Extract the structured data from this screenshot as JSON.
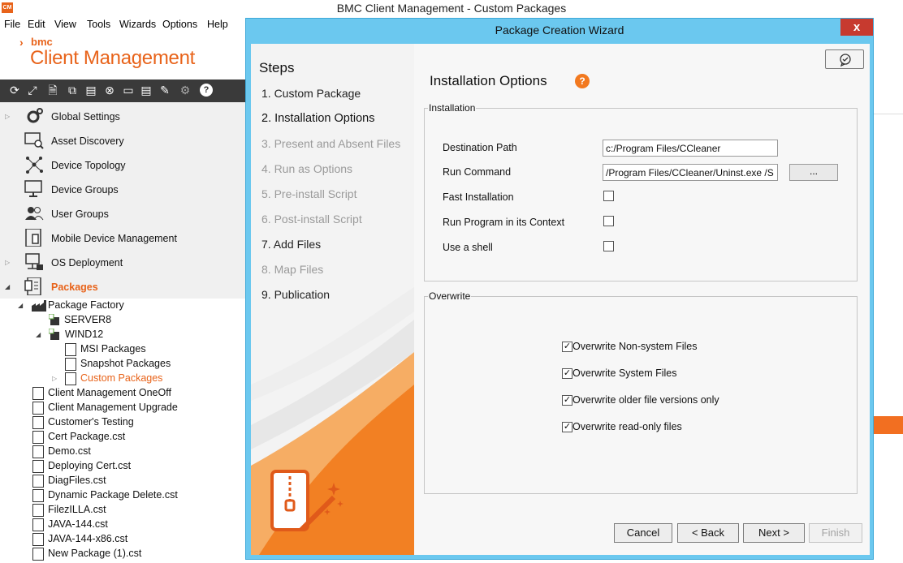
{
  "app": {
    "icon_text": "CM",
    "window_title": "BMC Client Management - Custom Packages",
    "logo_brand": "bmc",
    "logo_product": "Client Management",
    "brand_color": "#e8631a"
  },
  "menu": [
    {
      "label": "File"
    },
    {
      "label": "Edit"
    },
    {
      "label": "View"
    },
    {
      "label": "Tools"
    },
    {
      "label": "Wizards"
    },
    {
      "label": "Options"
    },
    {
      "label": "Help"
    }
  ],
  "toolbar": {
    "icons": [
      "refresh-icon",
      "fullscreen-icon",
      "new-doc-icon",
      "copy-icon",
      "paste-icon",
      "delete-icon",
      "folder-remove-icon",
      "properties-icon",
      "edit-doc-icon",
      "gear-icon",
      "help-icon"
    ]
  },
  "nav": {
    "items": [
      {
        "label": "Global Settings",
        "icon": "gear-icon"
      },
      {
        "label": "Asset Discovery",
        "icon": "monitor-search-icon"
      },
      {
        "label": "Device Topology",
        "icon": "topology-icon"
      },
      {
        "label": "Device Groups",
        "icon": "monitor-icon"
      },
      {
        "label": "User Groups",
        "icon": "users-icon"
      },
      {
        "label": "Mobile Device Management",
        "icon": "mobile-icon"
      },
      {
        "label": "OS Deployment",
        "icon": "os-deploy-icon"
      },
      {
        "label": "Packages",
        "icon": "package-icon",
        "active": true
      }
    ]
  },
  "tree": {
    "items": [
      {
        "label": "Package Factory",
        "level": 0
      },
      {
        "label": "SERVER8",
        "level": 1
      },
      {
        "label": "WIND12",
        "level": 1
      },
      {
        "label": "MSI Packages",
        "level": 2
      },
      {
        "label": "Snapshot Packages",
        "level": 2
      },
      {
        "label": "Custom Packages",
        "level": 2,
        "selected": true
      },
      {
        "label": "Client Management OneOff",
        "level": 0
      },
      {
        "label": "Client Management Upgrade",
        "level": 0
      },
      {
        "label": "Customer's Testing",
        "level": 0
      },
      {
        "label": "Cert Package.cst",
        "level": 0
      },
      {
        "label": "Demo.cst",
        "level": 0
      },
      {
        "label": "Deploying Cert.cst",
        "level": 0
      },
      {
        "label": "DiagFiles.cst",
        "level": 0
      },
      {
        "label": "Dynamic Package Delete.cst",
        "level": 0
      },
      {
        "label": "FilezILLA.cst",
        "level": 0
      },
      {
        "label": "JAVA-144.cst",
        "level": 0
      },
      {
        "label": "JAVA-144-x86.cst",
        "level": 0
      },
      {
        "label": "New Package (1).cst",
        "level": 0
      }
    ]
  },
  "dialog": {
    "title": "Package Creation Wizard",
    "close_label": "x",
    "steps_title": "Steps",
    "steps": [
      {
        "label": "1. Custom Package",
        "state": "done"
      },
      {
        "label": "2. Installation Options",
        "state": "current"
      },
      {
        "label": "3. Present and Absent Files",
        "state": "pending"
      },
      {
        "label": "4. Run as Options",
        "state": "pending"
      },
      {
        "label": "5. Pre-install Script",
        "state": "pending"
      },
      {
        "label": "6. Post-install Script",
        "state": "pending"
      },
      {
        "label": "7. Add Files",
        "state": "done"
      },
      {
        "label": "8. Map Files",
        "state": "pending"
      },
      {
        "label": "9. Publication",
        "state": "done"
      }
    ],
    "section_title": "Installation Options",
    "help_badge": "?",
    "installation": {
      "legend": "Installation",
      "destination_label": "Destination Path",
      "destination_value": "c:/Program Files/CCleaner",
      "run_command_label": "Run Command",
      "run_command_value": "/Program Files/CCleaner/Uninst.exe /S",
      "browse_label": "...",
      "fast_install_label": "Fast Installation",
      "fast_install_checked": false,
      "run_in_context_label": "Run Program in its Context",
      "run_in_context_checked": false,
      "use_shell_label": "Use a shell",
      "use_shell_checked": false
    },
    "overwrite": {
      "legend": "Overwrite",
      "options": [
        {
          "label": "Overwrite Non-system Files",
          "checked": true
        },
        {
          "label": "Overwrite System Files",
          "checked": true
        },
        {
          "label": "Overwrite older file versions only",
          "checked": true
        },
        {
          "label": "Overwrite read-only files",
          "checked": true
        }
      ]
    },
    "buttons": {
      "cancel": "Cancel",
      "back": "< Back",
      "next": "Next >",
      "finish": "Finish"
    }
  }
}
